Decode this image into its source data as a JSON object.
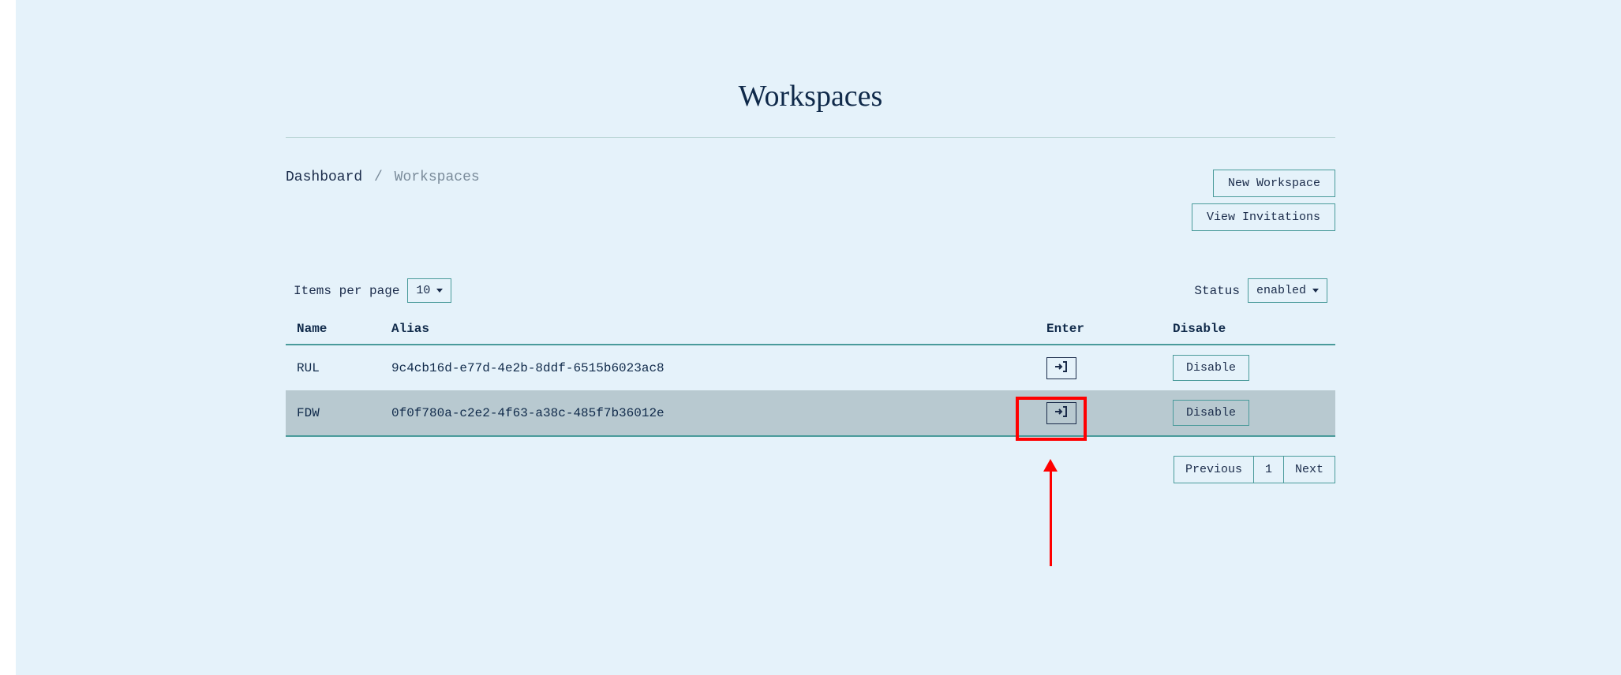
{
  "title": "Workspaces",
  "breadcrumb": {
    "link": "Dashboard",
    "separator": "/",
    "current": "Workspaces"
  },
  "actions": {
    "new_workspace": "New Workspace",
    "view_invitations": "View Invitations"
  },
  "controls": {
    "items_per_page_label": "Items per page",
    "items_per_page_value": "10",
    "status_label": "Status",
    "status_value": "enabled"
  },
  "table": {
    "headers": {
      "name": "Name",
      "alias": "Alias",
      "enter": "Enter",
      "disable": "Disable"
    },
    "rows": [
      {
        "name": "RUL",
        "alias": "9c4cb16d-e77d-4e2b-8ddf-6515b6023ac8",
        "disable_label": "Disable"
      },
      {
        "name": "FDW",
        "alias": "0f0f780a-c2e2-4f63-a38c-485f7b36012e",
        "disable_label": "Disable"
      }
    ]
  },
  "pagination": {
    "previous": "Previous",
    "page": "1",
    "next": "Next"
  }
}
